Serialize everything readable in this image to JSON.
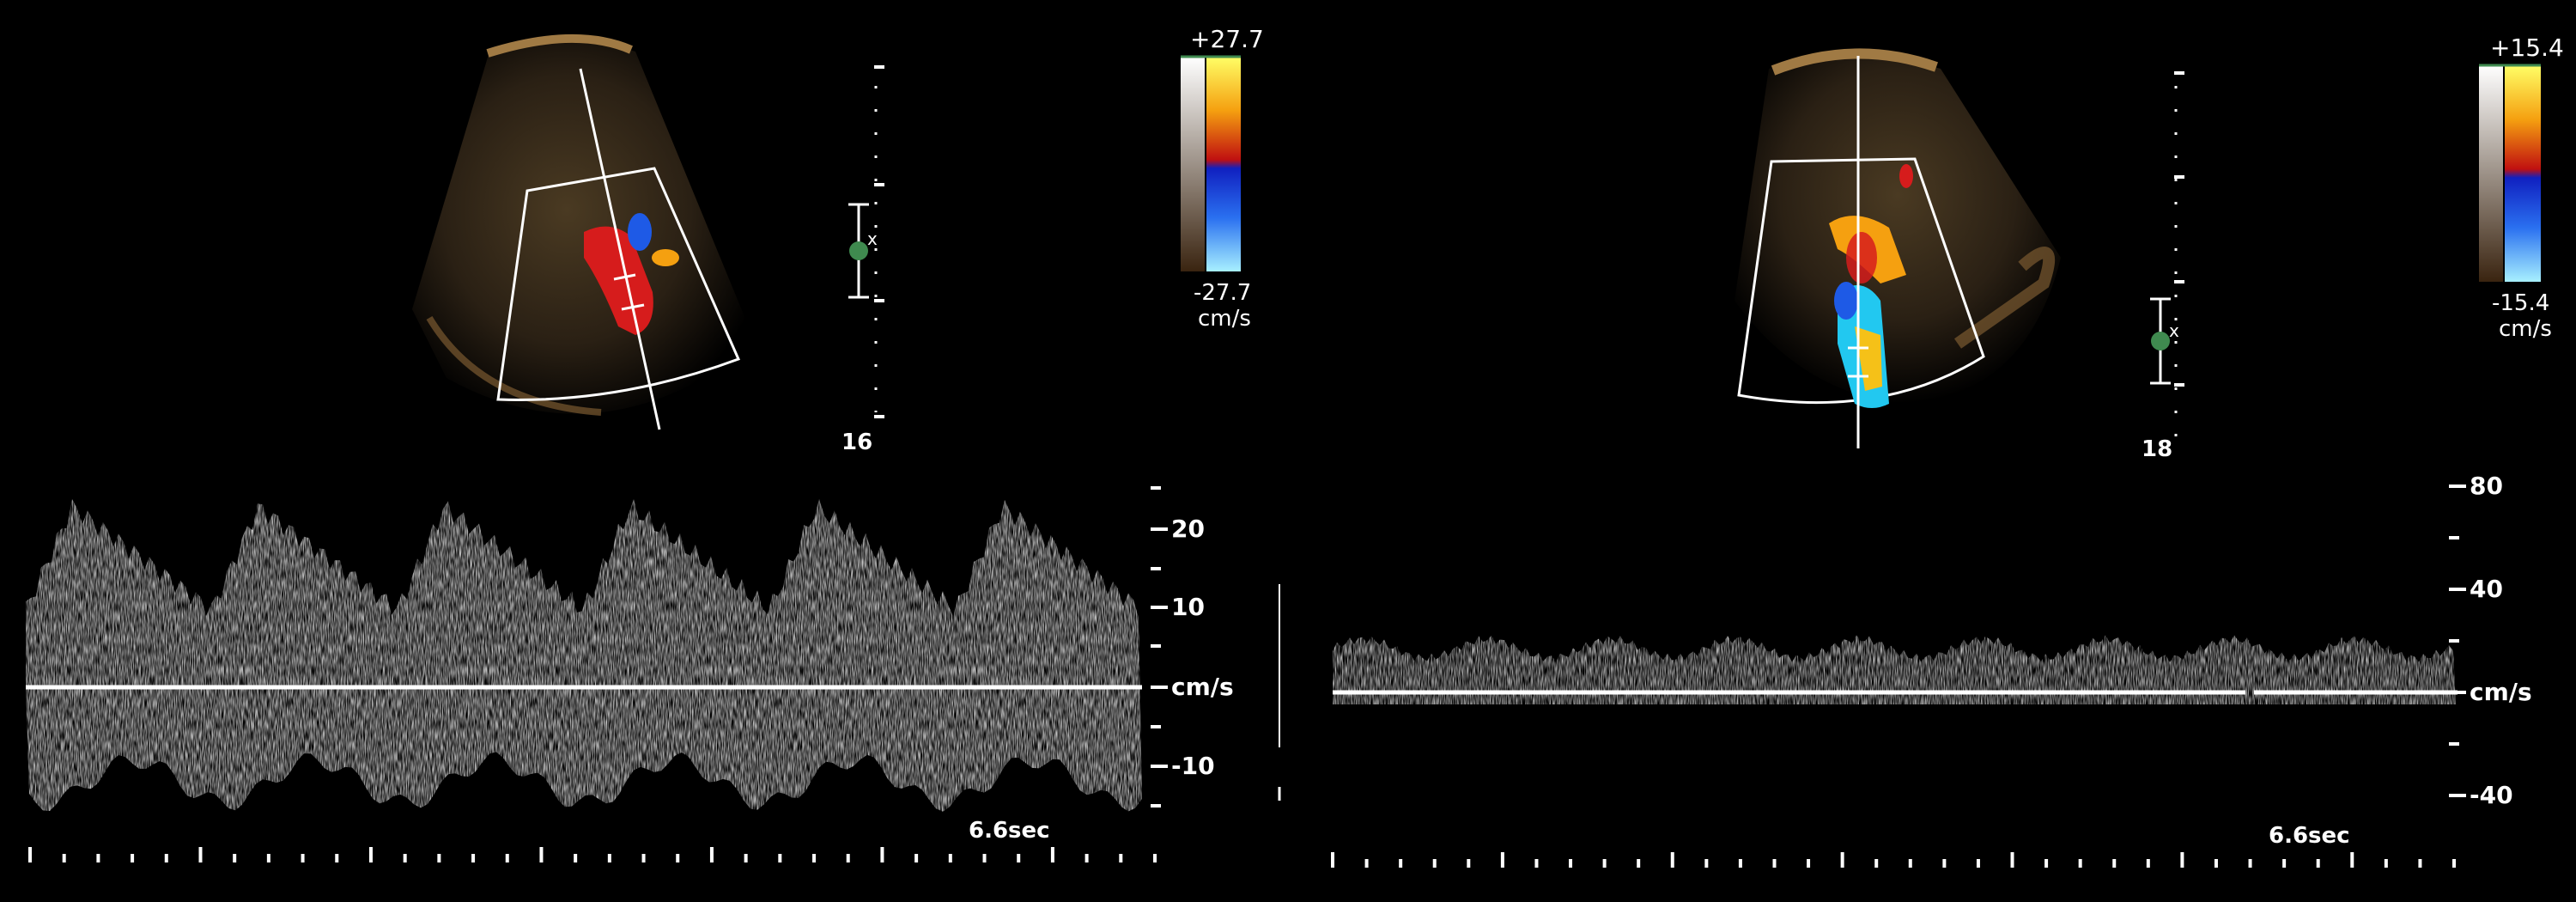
{
  "panels": [
    {
      "id": "left",
      "colorbar": {
        "max": "+27.7",
        "min": "-27.7",
        "unit": "cm/s"
      },
      "depth_marker": "16",
      "spectrum_scale": {
        "ticks": [
          "20",
          "10",
          "cm/s",
          "-10"
        ]
      },
      "sweep_time": "6.6sec"
    },
    {
      "id": "right",
      "colorbar": {
        "max": "+15.4",
        "min": "-15.4",
        "unit": "cm/s"
      },
      "depth_marker": "18",
      "spectrum_scale": {
        "ticks": [
          "80",
          "40",
          "cm/s",
          "-40"
        ]
      },
      "sweep_time": "6.6sec"
    }
  ],
  "colors": {
    "background": "#000000",
    "sector_tissue": "#8a6a3f",
    "doppler_red": "#d61c1c",
    "doppler_blue": "#1e5ae6",
    "doppler_cyan": "#22c8f0",
    "doppler_yellow": "#f5c118",
    "gate_marker": "#3f8a4f",
    "overlay": "#ffffff"
  },
  "icons": [
    "sample-volume-gate-icon",
    "focus-marker-icon"
  ]
}
